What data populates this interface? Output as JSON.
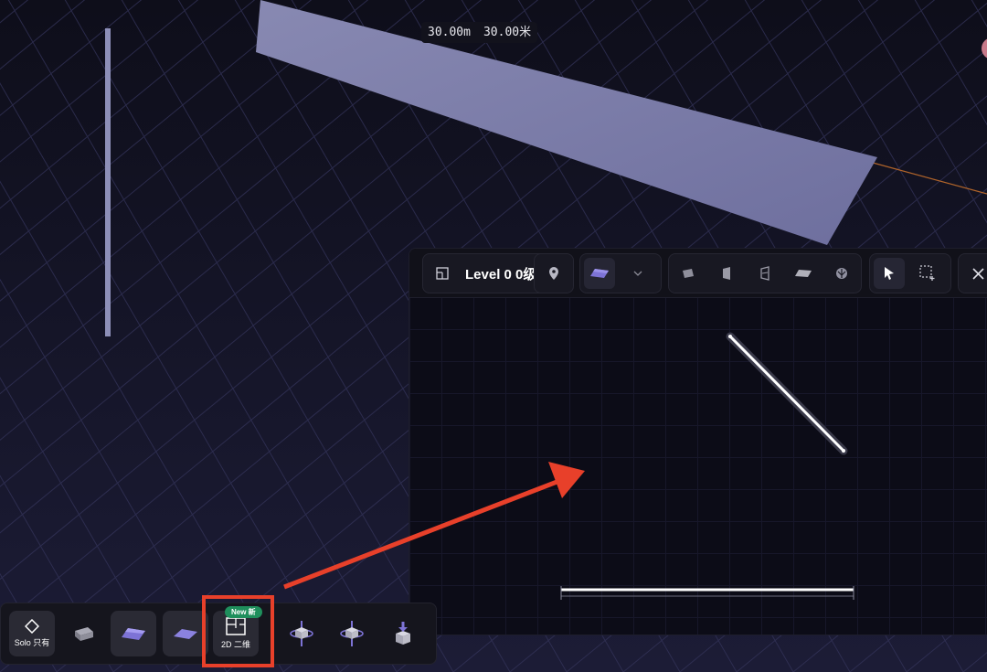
{
  "viewport": {
    "dimension_label": {
      "metric": "30.00m",
      "chinese": "30.00米"
    }
  },
  "floorplan_panel": {
    "level_title": "Level 0 0级",
    "tools": {
      "location": "location-pin-icon",
      "floor": "floor-tile-icon",
      "chevron": "chevron-down-icon",
      "wall": "wall-block-icon",
      "door": "door-icon",
      "window": "window-icon",
      "slab": "slab-icon",
      "object": "object-icon",
      "select": "pointer-icon",
      "marquee": "marquee-select-icon",
      "close": "close-icon"
    }
  },
  "bottom_toolbar": {
    "solo_label": "Solo 只有",
    "view2d_label": "2D 二维",
    "new_badge": "New 新"
  },
  "colors": {
    "accent_purple": "#7d73d6",
    "annotation_red": "#e8402a",
    "badge_green": "#1f8f5c"
  }
}
